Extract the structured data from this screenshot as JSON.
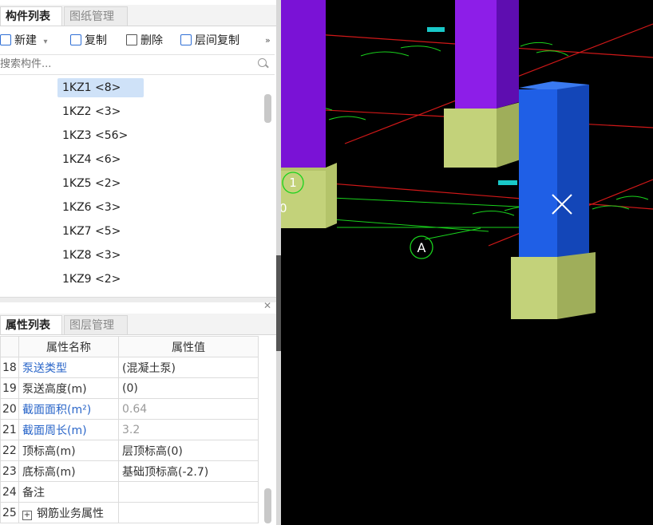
{
  "top_panel": {
    "tabs": [
      "构件列表",
      "图纸管理"
    ],
    "toolbar": {
      "new": "新建",
      "copy": "复制",
      "delete": "删除",
      "floor_copy": "层间复制",
      "more_icon": "double-chevron-right-icon"
    },
    "search_placeholder": "搜索构件...",
    "components": [
      "1KZ1 <8>",
      "1KZ2 <3>",
      "1KZ3 <56>",
      "1KZ4 <6>",
      "1KZ5 <2>",
      "1KZ6 <3>",
      "1KZ7 <5>",
      "1KZ8 <3>",
      "1KZ9 <2>"
    ],
    "selected_index": 0
  },
  "bottom_panel": {
    "tabs": [
      "属性列表",
      "图层管理"
    ],
    "columns": [
      "属性名称",
      "属性值"
    ],
    "rows": [
      {
        "num": "18",
        "name": "泵送类型",
        "value": "(混凝土泵)"
      },
      {
        "num": "19",
        "name": "泵送高度(m)",
        "value": "(0)"
      },
      {
        "num": "20",
        "name": "截面面积(m²)",
        "value": "0.64"
      },
      {
        "num": "21",
        "name": "截面周长(m)",
        "value": "3.2"
      },
      {
        "num": "22",
        "name": "顶标高(m)",
        "value": "层顶标高(0)"
      },
      {
        "num": "23",
        "name": "底标高(m)",
        "value": "基础顶标高(-2.7)"
      },
      {
        "num": "24",
        "name": "备注",
        "value": ""
      },
      {
        "num": "25",
        "name": "钢筋业务属性",
        "value": ""
      }
    ]
  },
  "viewport": {
    "axis_label_1": "1",
    "axis_label_a": "A",
    "axis_label_0": "0",
    "colors": {
      "background": "#000000",
      "column_purple": "#7a12d6",
      "column_blue": "#1f5fe6",
      "footing": "#b4c46a",
      "dim_green": "#19d21c",
      "axis_red": "#d01818"
    }
  }
}
